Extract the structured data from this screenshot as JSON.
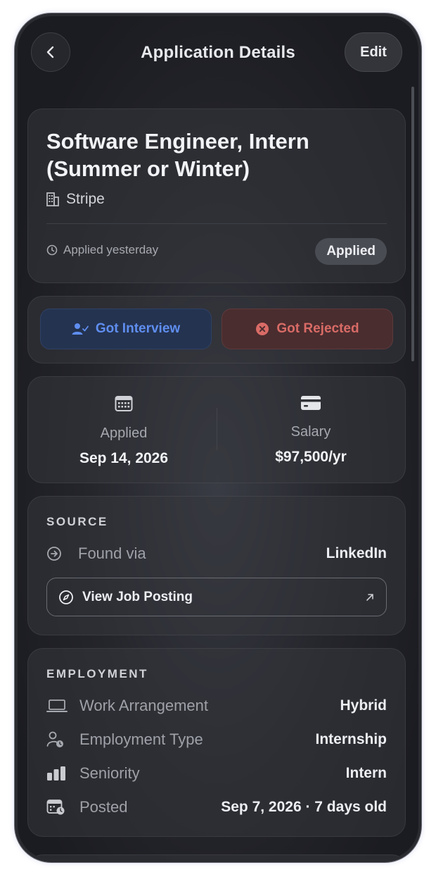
{
  "header": {
    "title": "Application Details",
    "edit_label": "Edit"
  },
  "job": {
    "title": "Software Engineer, Intern (Summer or Winter)",
    "company": "Stripe",
    "applied_when": "Applied yesterday",
    "status": "Applied"
  },
  "actions": {
    "interview_label": "Got Interview",
    "rejected_label": "Got Rejected"
  },
  "stats": {
    "applied_label": "Applied",
    "applied_value": "Sep 14, 2026",
    "salary_label": "Salary",
    "salary_value": "$97,500/yr"
  },
  "source": {
    "section_title": "SOURCE",
    "found_via_label": "Found via",
    "found_via_value": "LinkedIn",
    "view_posting_label": "View Job Posting"
  },
  "employment": {
    "section_title": "EMPLOYMENT",
    "rows": [
      {
        "label": "Work Arrangement",
        "value": "Hybrid"
      },
      {
        "label": "Employment Type",
        "value": "Internship"
      },
      {
        "label": "Seniority",
        "value": "Intern"
      },
      {
        "label": "Posted",
        "value": "Sep 7, 2026 · 7 days old"
      }
    ]
  },
  "colors": {
    "interview_accent": "#5f8ef0",
    "rejected_accent": "#d96b66",
    "background": "#1f2025"
  }
}
